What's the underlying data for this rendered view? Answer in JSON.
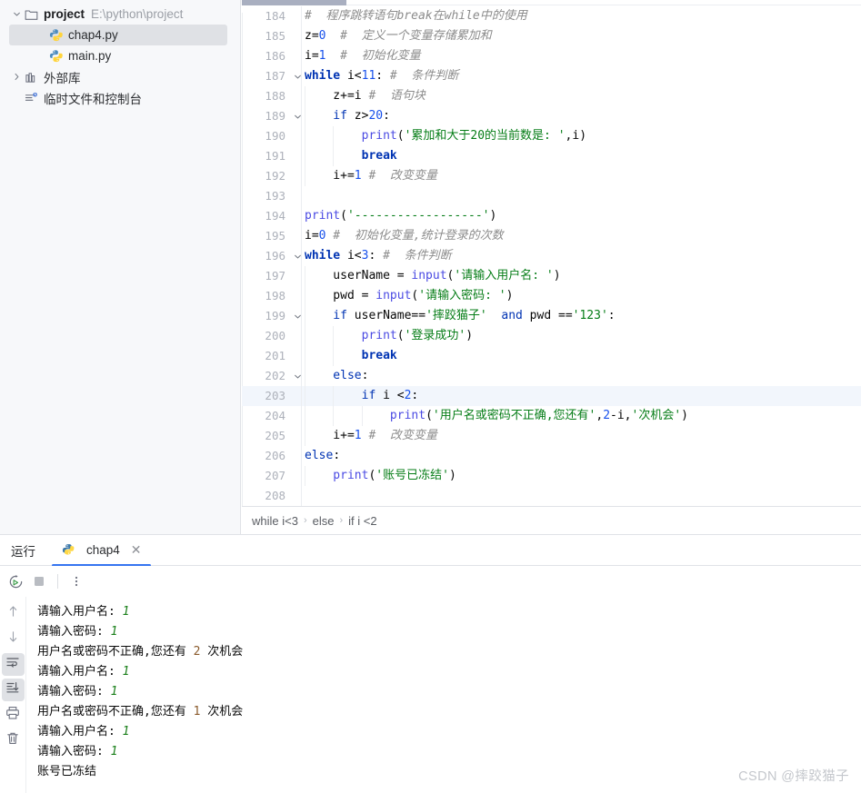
{
  "sidebar": {
    "items": [
      {
        "label": "project",
        "path": "E:\\python\\project",
        "icon": "folder-icon",
        "arrow": "chevron-down-icon",
        "depth": 0,
        "bold": true,
        "selected": false
      },
      {
        "label": "chap4.py",
        "path": "",
        "icon": "python-file-icon",
        "arrow": "",
        "depth": 1,
        "bold": false,
        "selected": true
      },
      {
        "label": "main.py",
        "path": "",
        "icon": "python-file-icon",
        "arrow": "",
        "depth": 1,
        "bold": false,
        "selected": false
      },
      {
        "label": "外部库",
        "path": "",
        "icon": "library-icon",
        "arrow": "chevron-right-icon",
        "depth": 0,
        "bold": false,
        "selected": false
      },
      {
        "label": "临时文件和控制台",
        "path": "",
        "icon": "scratches-icon",
        "arrow": "",
        "depth": 0,
        "bold": false,
        "selected": false
      }
    ]
  },
  "editor": {
    "scroll_thumb_label": "horizontal-scrollbar",
    "lines": [
      {
        "n": "184",
        "fold": "",
        "hl": false,
        "indents": 0,
        "tokens": [
          {
            "t": "com",
            "v": "#  程序跳转语句break在while中的使用"
          }
        ]
      },
      {
        "n": "185",
        "fold": "",
        "hl": false,
        "indents": 0,
        "tokens": [
          {
            "t": "var",
            "v": "z="
          },
          {
            "t": "num",
            "v": "0"
          },
          {
            "t": "com",
            "v": "  #  定义一个变量存储累加和"
          }
        ]
      },
      {
        "n": "186",
        "fold": "",
        "hl": false,
        "indents": 0,
        "tokens": [
          {
            "t": "var",
            "v": "i="
          },
          {
            "t": "num",
            "v": "1"
          },
          {
            "t": "com",
            "v": "  #  初始化变量"
          }
        ]
      },
      {
        "n": "187",
        "fold": "chevron-down-icon",
        "hl": false,
        "indents": 0,
        "tokens": [
          {
            "t": "kw",
            "v": "while"
          },
          {
            "t": "pl",
            "v": " i<"
          },
          {
            "t": "num",
            "v": "11"
          },
          {
            "t": "pl",
            "v": ":"
          },
          {
            "t": "com",
            "v": " #  条件判断"
          }
        ]
      },
      {
        "n": "188",
        "fold": "",
        "hl": false,
        "indents": 1,
        "tokens": [
          {
            "t": "pl",
            "v": "    z+=i"
          },
          {
            "t": "com",
            "v": " #  语句块"
          }
        ]
      },
      {
        "n": "189",
        "fold": "chevron-down-icon",
        "hl": false,
        "indents": 1,
        "tokens": [
          {
            "t": "kw2",
            "v": "    if"
          },
          {
            "t": "pl",
            "v": " z>"
          },
          {
            "t": "num",
            "v": "20"
          },
          {
            "t": "pl",
            "v": ":"
          }
        ]
      },
      {
        "n": "190",
        "fold": "",
        "hl": false,
        "indents": 2,
        "tokens": [
          {
            "t": "fn",
            "v": "        print"
          },
          {
            "t": "pl",
            "v": "("
          },
          {
            "t": "str",
            "v": "'累加和大于20的当前数是: '"
          },
          {
            "t": "pl",
            "v": ",i)"
          }
        ]
      },
      {
        "n": "191",
        "fold": "",
        "hl": false,
        "indents": 2,
        "tokens": [
          {
            "t": "kw",
            "v": "        break"
          }
        ]
      },
      {
        "n": "192",
        "fold": "",
        "hl": false,
        "indents": 1,
        "tokens": [
          {
            "t": "pl",
            "v": "    i+="
          },
          {
            "t": "num",
            "v": "1"
          },
          {
            "t": "com",
            "v": " #  改变变量"
          }
        ]
      },
      {
        "n": "193",
        "fold": "",
        "hl": false,
        "indents": 0,
        "tokens": []
      },
      {
        "n": "194",
        "fold": "",
        "hl": false,
        "indents": 0,
        "tokens": [
          {
            "t": "fn",
            "v": "print"
          },
          {
            "t": "pl",
            "v": "("
          },
          {
            "t": "str",
            "v": "'------------------'"
          },
          {
            "t": "pl",
            "v": ")"
          }
        ]
      },
      {
        "n": "195",
        "fold": "",
        "hl": false,
        "indents": 0,
        "tokens": [
          {
            "t": "var",
            "v": "i="
          },
          {
            "t": "num",
            "v": "0"
          },
          {
            "t": "com",
            "v": " #  初始化变量,统计登录的次数"
          }
        ]
      },
      {
        "n": "196",
        "fold": "chevron-down-icon",
        "hl": false,
        "indents": 0,
        "tokens": [
          {
            "t": "kw",
            "v": "while"
          },
          {
            "t": "pl",
            "v": " i<"
          },
          {
            "t": "num",
            "v": "3"
          },
          {
            "t": "pl",
            "v": ":"
          },
          {
            "t": "com",
            "v": " #  条件判断"
          }
        ]
      },
      {
        "n": "197",
        "fold": "",
        "hl": false,
        "indents": 1,
        "tokens": [
          {
            "t": "pl",
            "v": "    userName = "
          },
          {
            "t": "fn",
            "v": "input"
          },
          {
            "t": "pl",
            "v": "("
          },
          {
            "t": "str",
            "v": "'请输入用户名: '"
          },
          {
            "t": "pl",
            "v": ")"
          }
        ]
      },
      {
        "n": "198",
        "fold": "",
        "hl": false,
        "indents": 1,
        "tokens": [
          {
            "t": "pl",
            "v": "    pwd = "
          },
          {
            "t": "fn",
            "v": "input"
          },
          {
            "t": "pl",
            "v": "("
          },
          {
            "t": "str",
            "v": "'请输入密码: '"
          },
          {
            "t": "pl",
            "v": ")"
          }
        ]
      },
      {
        "n": "199",
        "fold": "chevron-down-icon",
        "hl": false,
        "indents": 1,
        "tokens": [
          {
            "t": "kw2",
            "v": "    if"
          },
          {
            "t": "pl",
            "v": " userName=="
          },
          {
            "t": "str",
            "v": "'摔跤猫子'"
          },
          {
            "t": "kw2",
            "v": "  and"
          },
          {
            "t": "pl",
            "v": " pwd =="
          },
          {
            "t": "str",
            "v": "'123'"
          },
          {
            "t": "pl",
            "v": ":"
          }
        ]
      },
      {
        "n": "200",
        "fold": "",
        "hl": false,
        "indents": 2,
        "tokens": [
          {
            "t": "fn",
            "v": "        print"
          },
          {
            "t": "pl",
            "v": "("
          },
          {
            "t": "str",
            "v": "'登录成功'"
          },
          {
            "t": "pl",
            "v": ")"
          }
        ]
      },
      {
        "n": "201",
        "fold": "",
        "hl": false,
        "indents": 2,
        "tokens": [
          {
            "t": "kw",
            "v": "        break"
          }
        ]
      },
      {
        "n": "202",
        "fold": "chevron-down-icon",
        "hl": false,
        "indents": 1,
        "tokens": [
          {
            "t": "kw2",
            "v": "    else"
          },
          {
            "t": "pl",
            "v": ":"
          }
        ]
      },
      {
        "n": "203",
        "fold": "",
        "hl": true,
        "indents": 2,
        "tokens": [
          {
            "t": "kw2",
            "v": "        if"
          },
          {
            "t": "pl",
            "v": " i <"
          },
          {
            "t": "num",
            "v": "2"
          },
          {
            "t": "pl",
            "v": ":"
          }
        ]
      },
      {
        "n": "204",
        "fold": "",
        "hl": false,
        "indents": 3,
        "tokens": [
          {
            "t": "fn",
            "v": "            print"
          },
          {
            "t": "pl",
            "v": "("
          },
          {
            "t": "str",
            "v": "'用户名或密码不正确,您还有'"
          },
          {
            "t": "pl",
            "v": ","
          },
          {
            "t": "num",
            "v": "2"
          },
          {
            "t": "pl",
            "v": "-i,"
          },
          {
            "t": "str",
            "v": "'次机会'"
          },
          {
            "t": "pl",
            "v": ")"
          }
        ]
      },
      {
        "n": "205",
        "fold": "",
        "hl": false,
        "indents": 1,
        "tokens": [
          {
            "t": "pl",
            "v": "    i+="
          },
          {
            "t": "num",
            "v": "1"
          },
          {
            "t": "com",
            "v": " #  改变变量"
          }
        ]
      },
      {
        "n": "206",
        "fold": "",
        "hl": false,
        "indents": 0,
        "tokens": [
          {
            "t": "kw2",
            "v": "else"
          },
          {
            "t": "pl",
            "v": ":"
          }
        ]
      },
      {
        "n": "207",
        "fold": "",
        "hl": false,
        "indents": 1,
        "tokens": [
          {
            "t": "fn",
            "v": "    print"
          },
          {
            "t": "pl",
            "v": "("
          },
          {
            "t": "str",
            "v": "'账号已冻结'"
          },
          {
            "t": "pl",
            "v": ")"
          }
        ]
      },
      {
        "n": "208",
        "fold": "",
        "hl": false,
        "indents": 0,
        "tokens": []
      }
    ],
    "breadcrumb": [
      "while i<3",
      "else",
      "if i <2"
    ],
    "breadcrumb_separator": "›"
  },
  "run_panel": {
    "title": "运行",
    "tab_label": "chap4",
    "tab_icon": "python-file-icon",
    "tab_close_icon": "close-icon",
    "toolbar": [
      {
        "name": "rerun-button",
        "icon": "rerun-icon"
      },
      {
        "name": "stop-button",
        "icon": "stop-icon"
      },
      {
        "name": "more-options-button",
        "icon": "vertical-dots-icon"
      }
    ],
    "side_toolbar": [
      {
        "name": "previous-occurrence-button",
        "icon": "arrow-up-icon",
        "active": false
      },
      {
        "name": "next-occurrence-button",
        "icon": "arrow-down-icon",
        "active": false
      },
      {
        "name": "soft-wrap-button",
        "icon": "soft-wrap-icon",
        "active": true
      },
      {
        "name": "scroll-to-end-button",
        "icon": "scroll-to-end-icon",
        "active": true
      },
      {
        "name": "print-button",
        "icon": "printer-icon",
        "active": false
      },
      {
        "name": "clear-all-button",
        "icon": "trash-icon",
        "active": false
      }
    ],
    "output": [
      {
        "parts": [
          {
            "t": "plain",
            "v": "请输入用户名: "
          },
          {
            "t": "input",
            "v": "1"
          }
        ]
      },
      {
        "parts": [
          {
            "t": "plain",
            "v": "请输入密码: "
          },
          {
            "t": "input",
            "v": "1"
          }
        ]
      },
      {
        "parts": [
          {
            "t": "plain",
            "v": "用户名或密码不正确,您还有 "
          },
          {
            "t": "num",
            "v": "2"
          },
          {
            "t": "plain",
            "v": " 次机会"
          }
        ]
      },
      {
        "parts": [
          {
            "t": "plain",
            "v": "请输入用户名: "
          },
          {
            "t": "input",
            "v": "1"
          }
        ]
      },
      {
        "parts": [
          {
            "t": "plain",
            "v": "请输入密码: "
          },
          {
            "t": "input",
            "v": "1"
          }
        ]
      },
      {
        "parts": [
          {
            "t": "plain",
            "v": "用户名或密码不正确,您还有 "
          },
          {
            "t": "num",
            "v": "1"
          },
          {
            "t": "plain",
            "v": " 次机会"
          }
        ]
      },
      {
        "parts": [
          {
            "t": "plain",
            "v": "请输入用户名: "
          },
          {
            "t": "input",
            "v": "1"
          }
        ]
      },
      {
        "parts": [
          {
            "t": "plain",
            "v": "请输入密码: "
          },
          {
            "t": "input",
            "v": "1"
          }
        ]
      },
      {
        "parts": [
          {
            "t": "plain",
            "v": "账号已冻结"
          }
        ]
      }
    ]
  },
  "watermark": {
    "text": "CSDN @摔跤猫子"
  },
  "colors": {
    "accent": "#3574f0",
    "selection": "#dfe1e5",
    "line_highlight": "#f2f6fc",
    "string": "#067d17",
    "keyword": "#0033b3",
    "comment": "#8c8c8c",
    "number": "#1750eb",
    "console_input": "#1a7f1a",
    "console_number": "#8a5a2b"
  }
}
